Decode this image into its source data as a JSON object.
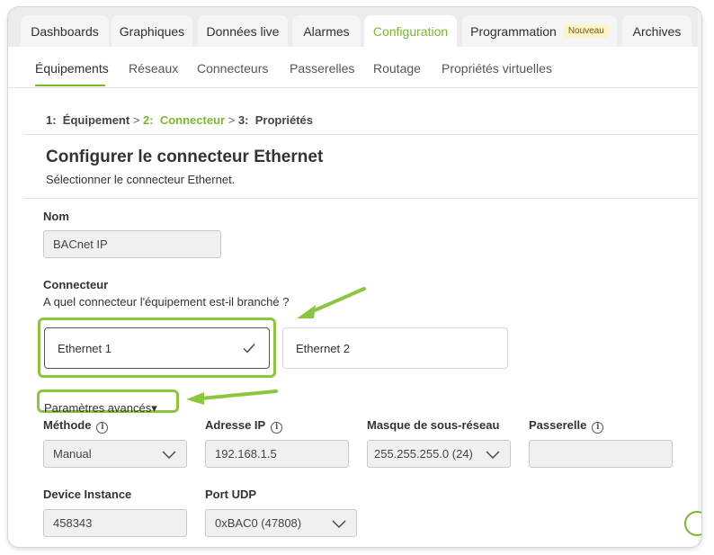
{
  "colors": {
    "accent": "#7ab929",
    "annotation_highlight": "#8cc63f"
  },
  "tabs": [
    {
      "label": "Dashboards",
      "active": false
    },
    {
      "label": "Graphiques",
      "active": false
    },
    {
      "label": "Données live",
      "active": false
    },
    {
      "label": "Alarmes",
      "active": false
    },
    {
      "label": "Configuration",
      "active": true
    },
    {
      "label": "Programmation",
      "badge": "Nouveau",
      "active": false
    },
    {
      "label": "Archives",
      "active": false
    }
  ],
  "subnav": [
    {
      "label": "Équipements",
      "active": true
    },
    {
      "label": "Réseaux",
      "active": false
    },
    {
      "label": "Connecteurs",
      "active": false
    },
    {
      "label": "Passerelles",
      "active": false
    },
    {
      "label": "Routage",
      "active": false
    },
    {
      "label": "Propriétés virtuelles",
      "active": false
    }
  ],
  "breadcrumb": {
    "step1_num": "1:",
    "step1": "Équipement",
    "sep": ">",
    "step2_num": "2:",
    "step2": "Connecteur",
    "step3_num": "3:",
    "step3": "Propriétés"
  },
  "page": {
    "title": "Configurer le connecteur Ethernet",
    "subtitle": "Sélectionner le connecteur Ethernet."
  },
  "form": {
    "name_label": "Nom",
    "name_value": "BACnet IP",
    "connector_label": "Connecteur",
    "connector_help": "A quel connecteur l'équipement est-il branché ?",
    "connectors": [
      {
        "label": "Ethernet 1",
        "selected": true
      },
      {
        "label": "Ethernet 2",
        "selected": false
      }
    ],
    "advanced_label": "Paramètres avancés",
    "method_label": "Méthode",
    "method_value": "Manual",
    "ip_label": "Adresse IP",
    "ip_value": "192.168.1.5",
    "mask_label": "Masque de sous-réseau",
    "mask_value": "255.255.255.0 (24)",
    "gateway_label": "Passerelle",
    "gateway_value": "",
    "device_instance_label": "Device Instance",
    "device_instance_value": "458343",
    "udp_port_label": "Port UDP",
    "udp_port_value": "0xBAC0 (47808)"
  },
  "icons": {
    "info": "i",
    "check": "check-icon",
    "chevron": "chevron-down-icon",
    "caret": "▾"
  }
}
